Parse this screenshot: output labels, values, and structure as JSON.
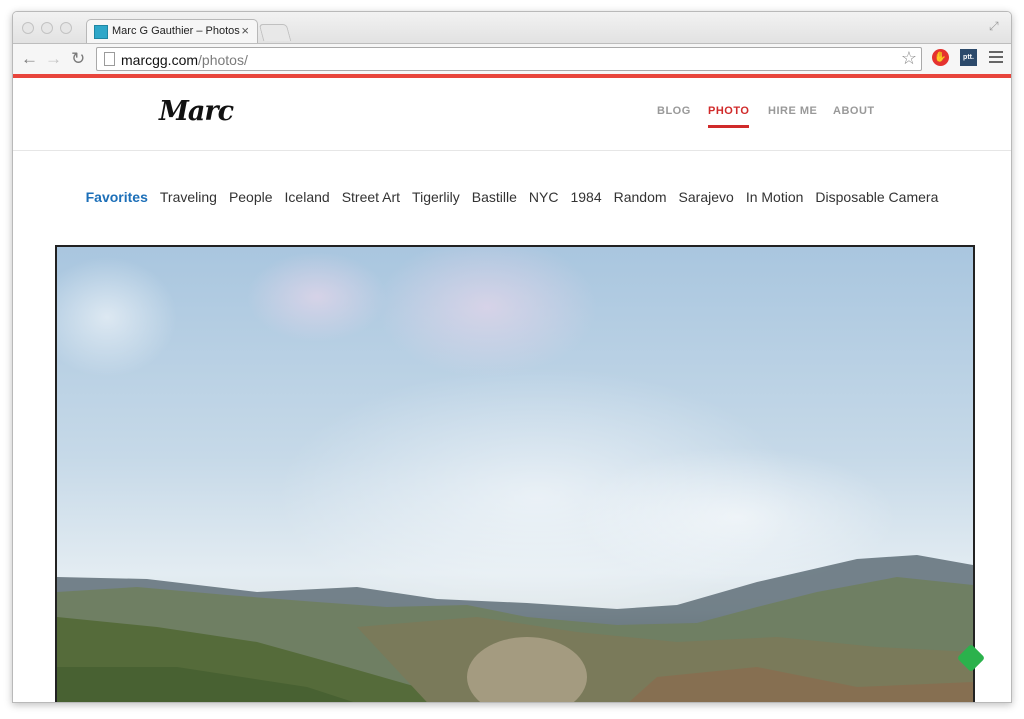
{
  "browser": {
    "tab_title": "Marc G Gauthier – Photos",
    "tab_close": "×",
    "url_host": "marcgg.com",
    "url_path": "/photos/",
    "extensions": {
      "ptt_label": "ptt."
    }
  },
  "site": {
    "logo": "Marc",
    "nav": [
      {
        "label": "BLOG",
        "active": false
      },
      {
        "label": "PHOTO",
        "active": true
      },
      {
        "label": "HIRE ME",
        "active": false
      },
      {
        "label": "ABOUT",
        "active": false
      }
    ],
    "categories": [
      {
        "label": "Favorites",
        "active": true
      },
      {
        "label": "Traveling",
        "active": false
      },
      {
        "label": "People",
        "active": false
      },
      {
        "label": "Iceland",
        "active": false
      },
      {
        "label": "Street Art",
        "active": false
      },
      {
        "label": "Tigerlily",
        "active": false
      },
      {
        "label": "Bastille",
        "active": false
      },
      {
        "label": "NYC",
        "active": false
      },
      {
        "label": "1984",
        "active": false
      },
      {
        "label": "Random",
        "active": false
      },
      {
        "label": "Sarajevo",
        "active": false
      },
      {
        "label": "In Motion",
        "active": false
      },
      {
        "label": "Disposable Camera",
        "active": false
      }
    ]
  },
  "colors": {
    "accent_red": "#e8453c",
    "active_nav": "#d02a2a",
    "active_category": "#1c6fb8"
  },
  "icons": [
    "back-arrow-icon",
    "forward-arrow-icon",
    "reload-icon",
    "page-icon",
    "star-icon",
    "menu-icon",
    "fullscreen-icon",
    "feedly-icon"
  ]
}
